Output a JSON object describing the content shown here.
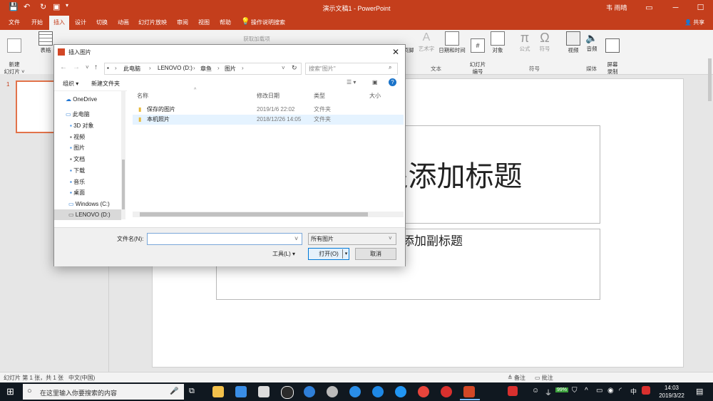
{
  "app": {
    "title": "演示文稿1 - PowerPoint",
    "user": "韦 雨晴",
    "share": "共享"
  },
  "tabs": [
    {
      "label": "文件"
    },
    {
      "label": "开始"
    },
    {
      "label": "插入"
    },
    {
      "label": "设计"
    },
    {
      "label": "切换"
    },
    {
      "label": "动画"
    },
    {
      "label": "幻灯片放映"
    },
    {
      "label": "审阅"
    },
    {
      "label": "视图"
    },
    {
      "label": "帮助"
    },
    {
      "label": "操作说明搜索"
    }
  ],
  "ribbon": {
    "new_slide": "新建\n幻灯片 ˅",
    "table": "表格",
    "get_addins": "获取加载项",
    "header_footer": "页脚",
    "wordart": "艺术字",
    "datetime": "日期和时间",
    "slide_number": "幻灯片\n编号",
    "object": "对象",
    "equation": "公式",
    "symbol": "符号",
    "video": "视频",
    "audio": "音频",
    "screen_record": "屏幕\n录制",
    "groups": {
      "slides": "幻灯片",
      "tables": "表格",
      "text": "文本",
      "symbols": "符号",
      "media": "媒体"
    }
  },
  "slide_panel": {
    "number": "1"
  },
  "slide": {
    "title_placeholder": "单击此处添加标题",
    "subtitle_placeholder": "单击此处添加副标题"
  },
  "statusbar": {
    "slide_info": "幻灯片 第 1 张，共 1 张",
    "language": "中文(中国)",
    "notes": "备注",
    "comments": "批注"
  },
  "dialog": {
    "title": "插入图片",
    "breadcrumb": [
      "此电脑",
      "LENOVO (D:)",
      "章鱼",
      "图片"
    ],
    "search_placeholder": "搜索\"图片\"",
    "organize": "组织 ▾",
    "new_folder": "新建文件夹",
    "nav": [
      {
        "label": "OneDrive",
        "icon": "cloud-icon"
      },
      {
        "label": "此电脑",
        "icon": "computer-icon"
      },
      {
        "label": "3D 对象",
        "icon": "folder-icon"
      },
      {
        "label": "视频",
        "icon": "folder-icon"
      },
      {
        "label": "图片",
        "icon": "folder-icon"
      },
      {
        "label": "文档",
        "icon": "folder-icon"
      },
      {
        "label": "下载",
        "icon": "folder-icon"
      },
      {
        "label": "音乐",
        "icon": "folder-icon"
      },
      {
        "label": "桌面",
        "icon": "folder-icon"
      },
      {
        "label": "Windows (C:)",
        "icon": "drive-icon"
      },
      {
        "label": "LENOVO (D:)",
        "icon": "drive-icon"
      }
    ],
    "columns": [
      "名称",
      "修改日期",
      "类型",
      "大小"
    ],
    "files": [
      {
        "name": "保存的图片",
        "date": "2019/1/6 22:02",
        "type": "文件夹",
        "size": ""
      },
      {
        "name": "本机照片",
        "date": "2018/12/26 14:05",
        "type": "文件夹",
        "size": ""
      }
    ],
    "filename_label": "文件名(N):",
    "filename_value": "",
    "filetype_value": "所有图片",
    "tools": "工具(L)",
    "open": "打开(O)",
    "cancel": "取消"
  },
  "taskbar": {
    "search_placeholder": "在这里输入你要搜索的内容",
    "battery": "99%",
    "ime": "中",
    "time": "14:03",
    "date": "2019/3/22"
  },
  "colors": {
    "accent": "#c43e1c",
    "taskbar": "#101820",
    "selection": "#cce8ff"
  }
}
